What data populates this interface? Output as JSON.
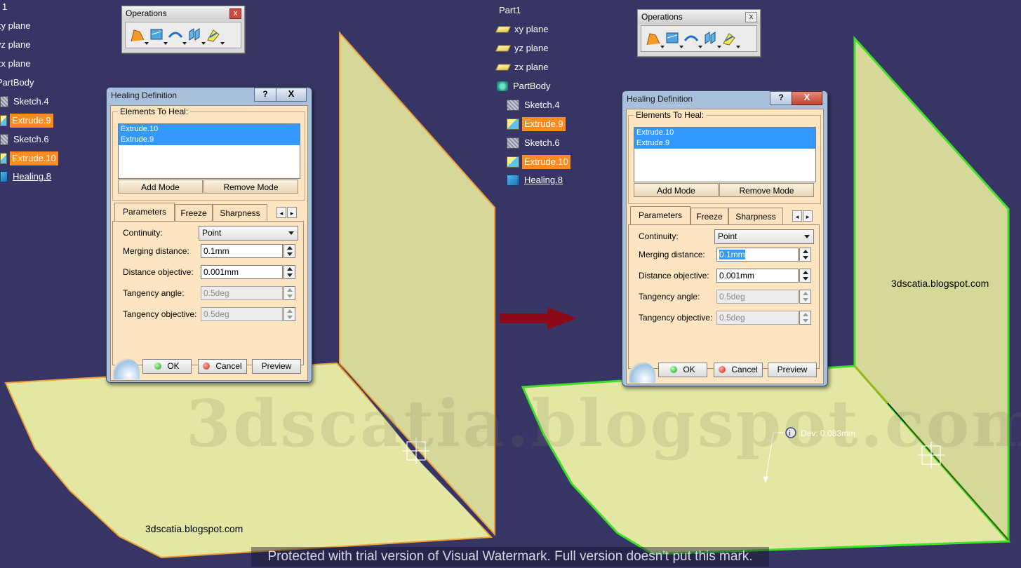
{
  "left_view": {
    "tree": [
      {
        "label": "1",
        "icon": "",
        "state": "normal"
      },
      {
        "label": "xy plane",
        "icon": "plane-icon",
        "state": "normal"
      },
      {
        "label": "yz plane",
        "icon": "plane-icon",
        "state": "normal"
      },
      {
        "label": "zx plane",
        "icon": "plane-icon",
        "state": "normal"
      },
      {
        "label": "PartBody",
        "icon": "partbody-icon",
        "state": "normal"
      },
      {
        "label": "Sketch.4",
        "icon": "sketch-icon",
        "state": "normal"
      },
      {
        "label": "Extrude.9",
        "icon": "extrude-icon",
        "state": "selected"
      },
      {
        "label": "Sketch.6",
        "icon": "sketch-icon",
        "state": "normal"
      },
      {
        "label": "Extrude.10",
        "icon": "extrude-icon",
        "state": "selected"
      },
      {
        "label": "Healing.8",
        "icon": "healing-icon",
        "state": "underlined"
      }
    ],
    "tree_visible": [
      "1",
      "xy plane",
      "yz plane",
      "zx plane",
      "PartBody",
      "Sketch.4",
      "Extrude.9",
      "Sketch.6",
      "Extrude.10",
      "Healing.8"
    ],
    "watermark_label": "3dscatia.blogspot.com"
  },
  "right_view": {
    "tree": [
      {
        "label": "Part1"
      },
      {
        "label": "xy plane"
      },
      {
        "label": "yz plane"
      },
      {
        "label": "zx plane"
      },
      {
        "label": "PartBody"
      },
      {
        "label": "Sketch.4"
      },
      {
        "label": "Extrude.9"
      },
      {
        "label": "Sketch.6"
      },
      {
        "label": "Extrude.10"
      },
      {
        "label": "Healing.8"
      }
    ],
    "watermark_label": "3dscatia.blogspot.com",
    "deviation_label": "Dev: 0.083mm"
  },
  "toolbar": {
    "title": "Operations",
    "close_label": "x",
    "tools": [
      "join-icon",
      "healing-tool-icon",
      "untrim-icon",
      "disassemble-icon",
      "extract-icon"
    ]
  },
  "dialog": {
    "title": "Healing Definition",
    "help_label": "?",
    "close_label": "X",
    "elements_label": "Elements To Heal:",
    "elements": [
      "Extrude.10",
      "Extrude.9"
    ],
    "add_mode": "Add Mode",
    "remove_mode": "Remove Mode",
    "tabs": [
      "Parameters",
      "Freeze",
      "Sharpness"
    ],
    "tab_prev": "◂",
    "tab_next": "▸",
    "continuity_label": "Continuity:",
    "continuity_value": "Point",
    "merging_label": "Merging distance:",
    "merging_value": "0.1mm",
    "distance_objective_label": "Distance objective:",
    "distance_objective_value": "0.001mm",
    "tangency_angle_label": "Tangency angle:",
    "tangency_angle_value": "0.5deg",
    "tangency_objective_label": "Tangency objective:",
    "tangency_objective_value": "0.5deg",
    "ok": "OK",
    "cancel": "Cancel",
    "preview": "Preview"
  },
  "arrow_color": "#8b0a1a",
  "background_color": "#363566",
  "surface_color": "#e4e6a3",
  "watermark_text": "3dscatia.blogspot.com",
  "trial_notice": "Protected with trial version of Visual Watermark. Full version doesn't put this mark."
}
